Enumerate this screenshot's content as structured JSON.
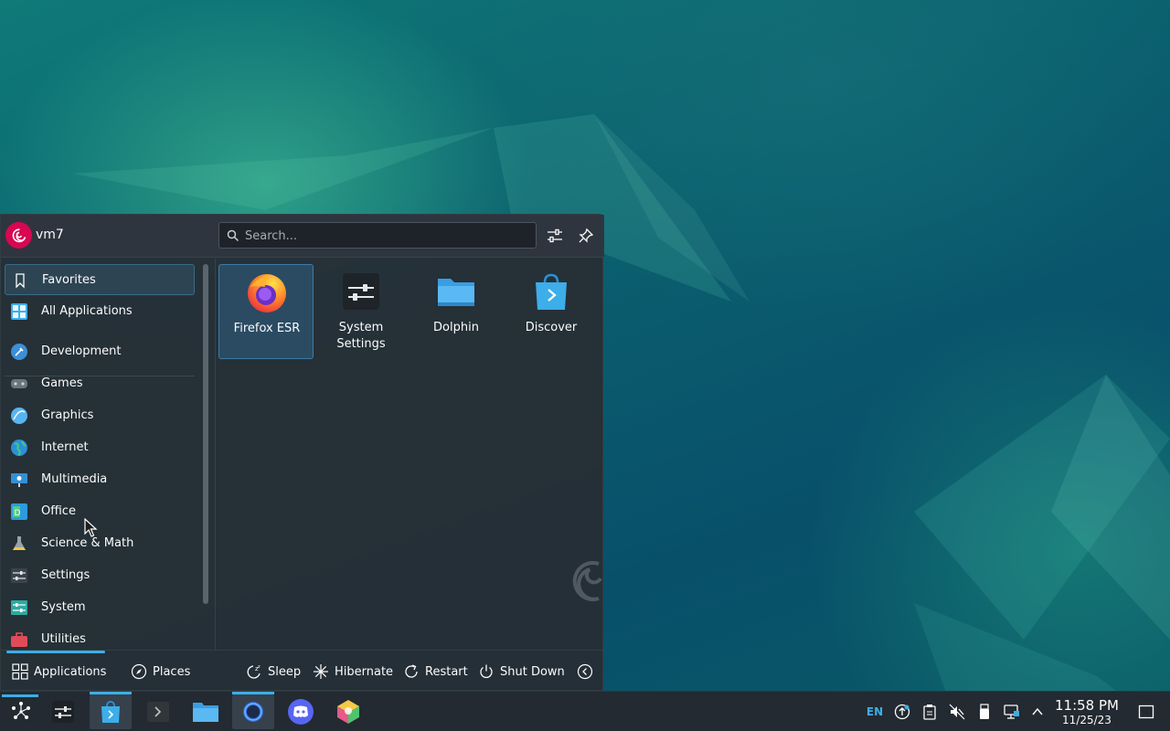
{
  "launcher": {
    "username": "vm7",
    "search_placeholder": "Search...",
    "categories": [
      {
        "label": "Favorites",
        "icon": "bookmark-icon",
        "selected": true
      },
      {
        "label": "All Applications",
        "icon": "grid-icon"
      },
      {
        "label": "Development",
        "icon": "development-icon"
      },
      {
        "label": "Games",
        "icon": "gamepad-icon"
      },
      {
        "label": "Graphics",
        "icon": "graphics-icon"
      },
      {
        "label": "Internet",
        "icon": "globe-icon"
      },
      {
        "label": "Multimedia",
        "icon": "multimedia-icon"
      },
      {
        "label": "Office",
        "icon": "office-icon"
      },
      {
        "label": "Science & Math",
        "icon": "flask-icon"
      },
      {
        "label": "Settings",
        "icon": "settings-icon"
      },
      {
        "label": "System",
        "icon": "system-icon"
      },
      {
        "label": "Utilities",
        "icon": "utilities-icon"
      }
    ],
    "favorites": [
      {
        "label": "Firefox ESR",
        "icon": "firefox-icon",
        "selected": true
      },
      {
        "label": "System Settings",
        "icon": "system-settings-icon"
      },
      {
        "label": "Dolphin",
        "icon": "folder-icon"
      },
      {
        "label": "Discover",
        "icon": "discover-icon"
      }
    ],
    "footer": {
      "applications": "Applications",
      "places": "Places",
      "sleep": "Sleep",
      "hibernate": "Hibernate",
      "restart": "Restart",
      "shutdown": "Shut Down"
    }
  },
  "panel": {
    "tasks": [
      "application-launcher",
      "system-settings",
      "discover",
      "konsole",
      "dolphin",
      "firefox",
      "discord",
      "app-store"
    ],
    "tray": {
      "language": "EN"
    },
    "clock": {
      "time": "11:58 PM",
      "date": "11/25/23"
    }
  },
  "colors": {
    "accent": "#3daee9",
    "debian_red": "#d70751"
  }
}
